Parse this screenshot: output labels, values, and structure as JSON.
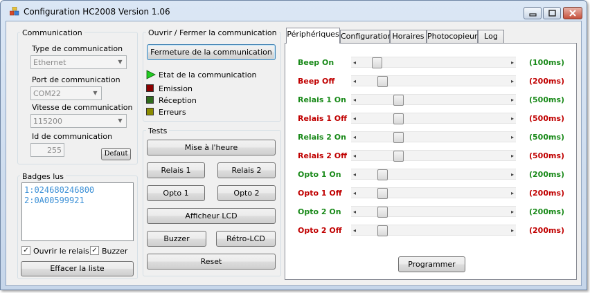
{
  "window": {
    "title": "Configuration HC2008 Version 1.06"
  },
  "communication": {
    "group_title": "Communication",
    "type_label": "Type de communication",
    "type_value": "Ethernet",
    "port_label": "Port de communication",
    "port_value": "COM22",
    "speed_label": "Vitesse de communication",
    "speed_value": "115200",
    "id_label": "Id de communication",
    "id_value": "255",
    "default_button": "Defaut"
  },
  "badges": {
    "group_title": "Badges lus",
    "items": [
      "1:024680246800",
      "2:0A00599921"
    ],
    "open_relay_label": "Ouvrir le relais",
    "open_relay_checked": true,
    "buzzer_label": "Buzzer",
    "buzzer_checked": true,
    "clear_button": "Effacer la liste"
  },
  "open_close": {
    "group_title": "Ouvrir / Fermer la communication",
    "close_button": "Fermeture de la communication",
    "status_label": "Etat de la communication",
    "emission_label": "Emission",
    "reception_label": "Réception",
    "errors_label": "Erreurs",
    "colors": {
      "status": "#22cc22",
      "emission": "#8b0000",
      "reception": "#2f6b1c",
      "errors": "#8b8b00"
    }
  },
  "tests": {
    "group_title": "Tests",
    "set_time_button": "Mise à l'heure",
    "relay1_button": "Relais 1",
    "relay2_button": "Relais 2",
    "opto1_button": "Opto 1",
    "opto2_button": "Opto 2",
    "lcd_button": "Afficheur LCD",
    "buzzer_button": "Buzzer",
    "backlight_button": "Rétro-LCD",
    "reset_button": "Reset"
  },
  "tabs": [
    {
      "label": "Périphériques",
      "active": true
    },
    {
      "label": "Configuration",
      "active": false
    },
    {
      "label": "Horaires",
      "active": false
    },
    {
      "label": "Photocopieur",
      "active": false
    },
    {
      "label": "Log",
      "active": false
    }
  ],
  "peripherals": {
    "sliders": [
      {
        "label": "Beep On",
        "value": "(100ms)",
        "color": "green",
        "position": 0.08
      },
      {
        "label": "Beep Off",
        "value": "(200ms)",
        "color": "red",
        "position": 0.12
      },
      {
        "label": "Relais 1 On",
        "value": "(500ms)",
        "color": "green",
        "position": 0.24
      },
      {
        "label": "Relais 1 Off",
        "value": "(500ms)",
        "color": "red",
        "position": 0.24
      },
      {
        "label": "Relais 2 On",
        "value": "(500ms)",
        "color": "green",
        "position": 0.24
      },
      {
        "label": "Relais 2 Off",
        "value": "(500ms)",
        "color": "red",
        "position": 0.24
      },
      {
        "label": "Opto 1 On",
        "value": "(200ms)",
        "color": "green",
        "position": 0.12
      },
      {
        "label": "Opto 1 Off",
        "value": "(200ms)",
        "color": "red",
        "position": 0.12
      },
      {
        "label": "Opto 2 On",
        "value": "(200ms)",
        "color": "green",
        "position": 0.12
      },
      {
        "label": "Opto 2 Off",
        "value": "(200ms)",
        "color": "red",
        "position": 0.12
      }
    ],
    "program_button": "Programmer"
  }
}
